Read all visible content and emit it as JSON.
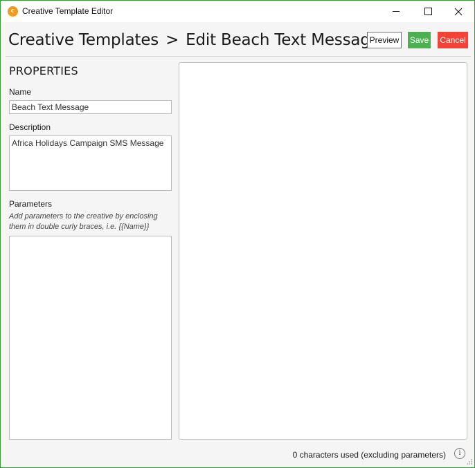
{
  "window": {
    "title": "Creative Template Editor",
    "app_icon_text": "C"
  },
  "header": {
    "breadcrumb_root": "Creative Templates",
    "separator": ">",
    "current": "Edit Beach Text Message"
  },
  "toolbar": {
    "preview_label": "Preview",
    "save_label": "Save",
    "cancel_label": "Cancel"
  },
  "properties": {
    "heading": "PROPERTIES",
    "name_label": "Name",
    "name_value": "Beach Text Message",
    "description_label": "Description",
    "description_value": "Africa Holidays Campaign SMS Message",
    "parameters_label": "Parameters",
    "parameters_hint": "Add parameters to the creative by enclosing them in double curly braces, i.e. {{Name}}",
    "parameters_value": ""
  },
  "editor": {
    "content": ""
  },
  "status": {
    "characters_used": "0 characters used (excluding parameters)",
    "info_glyph": "i"
  },
  "colors": {
    "window_border": "#3a9a3a",
    "save_button": "#4caf50",
    "cancel_button": "#f44336",
    "app_icon": "#f39a1e"
  }
}
